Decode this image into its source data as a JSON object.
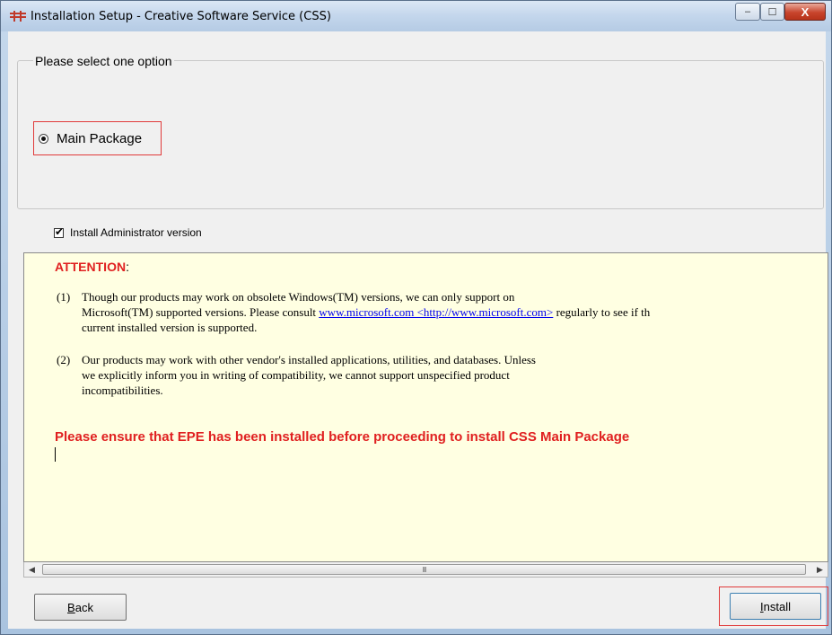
{
  "window": {
    "title": "Installation Setup - Creative Software Service (CSS)",
    "controls": {
      "minimize": "–",
      "maximize": "☐",
      "close": "X"
    }
  },
  "options_group": {
    "legend": "Please select one option",
    "radio_label": "Main Package",
    "radio_selected": true
  },
  "admin_checkbox": {
    "label": "Install Administrator version",
    "checked": true
  },
  "notice": {
    "heading": "ATTENTION",
    "heading_suffix": ":",
    "item1": {
      "num": "(1)",
      "line1": "Though our products may work on obsolete Windows(TM) versions, we can only support on",
      "line2_pre": "Microsoft(TM) supported versions. Please consult ",
      "line2_link": "www.microsoft.com <http://www.microsoft.com>",
      "line2_post": " regularly to see if th",
      "line3": "current installed version is supported."
    },
    "item2": {
      "num": "(2)",
      "line1": "Our products may work with other vendor's installed applications, utilities, and databases. Unless",
      "line2": "we explicitly inform you in writing of compatibility, we cannot support unspecified product",
      "line3": "incompatibilities."
    },
    "warning": "Please ensure that EPE has been installed before proceeding to install CSS Main Package"
  },
  "scrollbar": {
    "thumb_grip": "III"
  },
  "buttons": {
    "back_accel": "B",
    "back_rest": "ack",
    "install_accel": "I",
    "install_rest": "nstall"
  }
}
